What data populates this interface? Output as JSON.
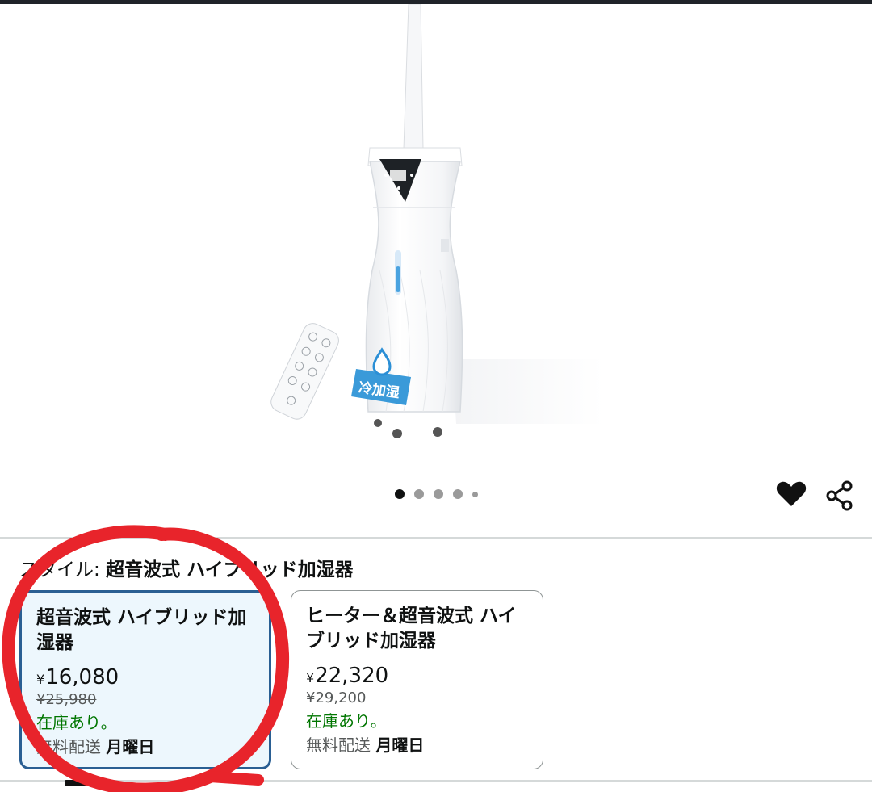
{
  "product": {
    "image_badge": "冷加湿",
    "carousel": {
      "count": 5,
      "active_index": 0
    }
  },
  "actions": {
    "favorite_icon": "heart-icon",
    "share_icon": "share-icon"
  },
  "style_selector": {
    "label": "スタイル:",
    "selected_value": "超音波式 ハイブリッド加湿器",
    "options": [
      {
        "title": "超音波式 ハイブリッド加湿器",
        "price_symbol": "¥",
        "price": "16,080",
        "list_price": "¥25,980",
        "availability": "在庫あり。",
        "shipping_prefix": "無料配送",
        "shipping_day": "月曜日",
        "selected": true
      },
      {
        "title": "ヒーター＆超音波式 ハイブリッド加湿器",
        "price_symbol": "¥",
        "price": "22,320",
        "list_price": "¥29,200",
        "availability": "在庫あり。",
        "shipping_prefix": "無料配送",
        "shipping_day": "月曜日",
        "selected": false
      }
    ]
  },
  "colors": {
    "selected_border": "#2a5f93",
    "selected_bg": "#edf7fd",
    "in_stock": "#007600",
    "annotation": "#e8242b"
  }
}
